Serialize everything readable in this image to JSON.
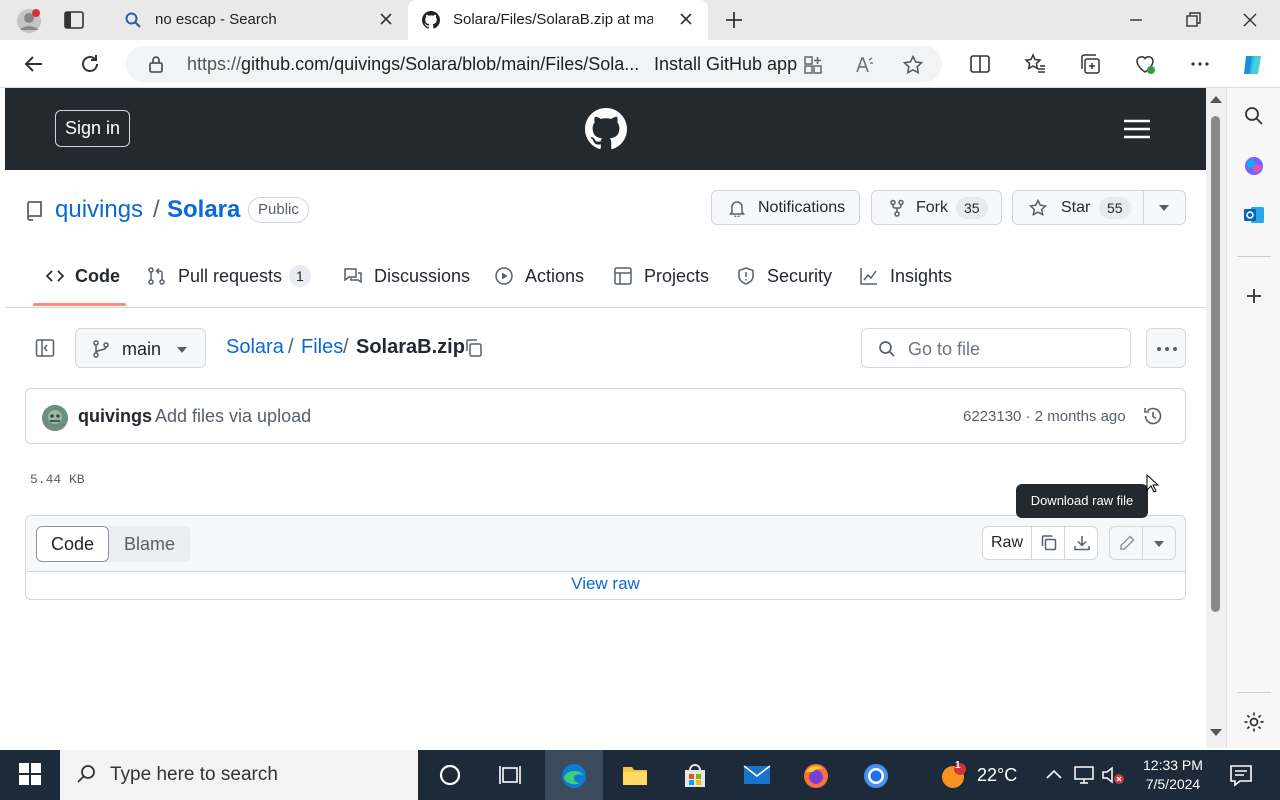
{
  "browser": {
    "tabs": [
      {
        "title": "no escap - Search",
        "active": false
      },
      {
        "title": "Solara/Files/SolaraB.zip at main · ",
        "active": true
      }
    ],
    "url_prefix": "https://",
    "url_main": "github.com/quivings/Solara/blob/main/Files/Sola...",
    "install_label": "Install GitHub app"
  },
  "github": {
    "signin_label": "Sign in",
    "owner": "quivings",
    "slash": "/",
    "repo": "Solara",
    "visibility": "Public",
    "notifications_label": "Notifications",
    "fork_label": "Fork",
    "fork_count": "35",
    "star_label": "Star",
    "star_count": "55",
    "nav": [
      {
        "label": "Code"
      },
      {
        "label": "Pull requests",
        "count": "1"
      },
      {
        "label": "Discussions"
      },
      {
        "label": "Actions"
      },
      {
        "label": "Projects"
      },
      {
        "label": "Security"
      },
      {
        "label": "Insights"
      }
    ],
    "branch": "main",
    "breadcrumb": {
      "root": "Solara",
      "folder": "Files",
      "file": "SolaraB.zip",
      "sep": "/"
    },
    "goto_placeholder": "Go to file",
    "commit": {
      "author": "quivings",
      "message": "Add files via upload",
      "meta": "6223130 · 2 months ago"
    },
    "file_size": "5.44 KB",
    "tooltip": "Download raw file",
    "view_modes": {
      "code": "Code",
      "blame": "Blame"
    },
    "raw_label": "Raw",
    "view_raw": "View raw"
  },
  "taskbar": {
    "search_placeholder": "Type here to search",
    "temperature": "22°C",
    "time": "12:33 PM",
    "date": "7/5/2024",
    "weather_badge": "1"
  },
  "colors": {
    "link": "#0969da",
    "header_bg": "#24292f",
    "tab_underline": "#fd8c73",
    "taskbar_bg": "#1c2a3a"
  }
}
